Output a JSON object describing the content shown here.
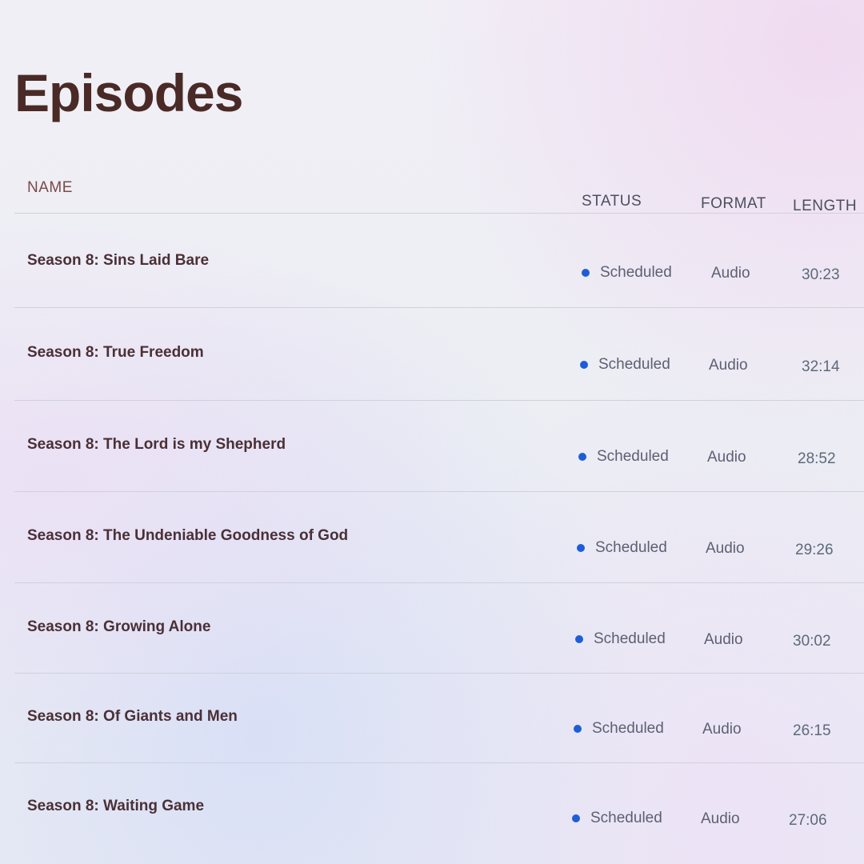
{
  "page": {
    "title": "Episodes"
  },
  "table": {
    "columns": {
      "name": "NAME",
      "status": "STATUS",
      "format": "FORMAT",
      "length": "LENGTH"
    },
    "rows": [
      {
        "name": "Season 8: Sins Laid Bare",
        "status": "Scheduled",
        "format": "Audio",
        "length": "30:23"
      },
      {
        "name": "Season 8: True Freedom",
        "status": "Scheduled",
        "format": "Audio",
        "length": "32:14"
      },
      {
        "name": "Season 8: The Lord is my Shepherd",
        "status": "Scheduled",
        "format": "Audio",
        "length": "28:52"
      },
      {
        "name": "Season 8: The Undeniable Goodness of God",
        "status": "Scheduled",
        "format": "Audio",
        "length": "29:26"
      },
      {
        "name": "Season 8: Growing Alone",
        "status": "Scheduled",
        "format": "Audio",
        "length": "30:02"
      },
      {
        "name": "Season 8: Of Giants and Men",
        "status": "Scheduled",
        "format": "Audio",
        "length": "26:15"
      },
      {
        "name": "Season 8: Waiting Game",
        "status": "Scheduled",
        "format": "Audio",
        "length": "27:06"
      }
    ]
  },
  "colors": {
    "title": "#4a2a26",
    "status_dot": "#1d5ed6",
    "divider": "#cfd1da"
  }
}
